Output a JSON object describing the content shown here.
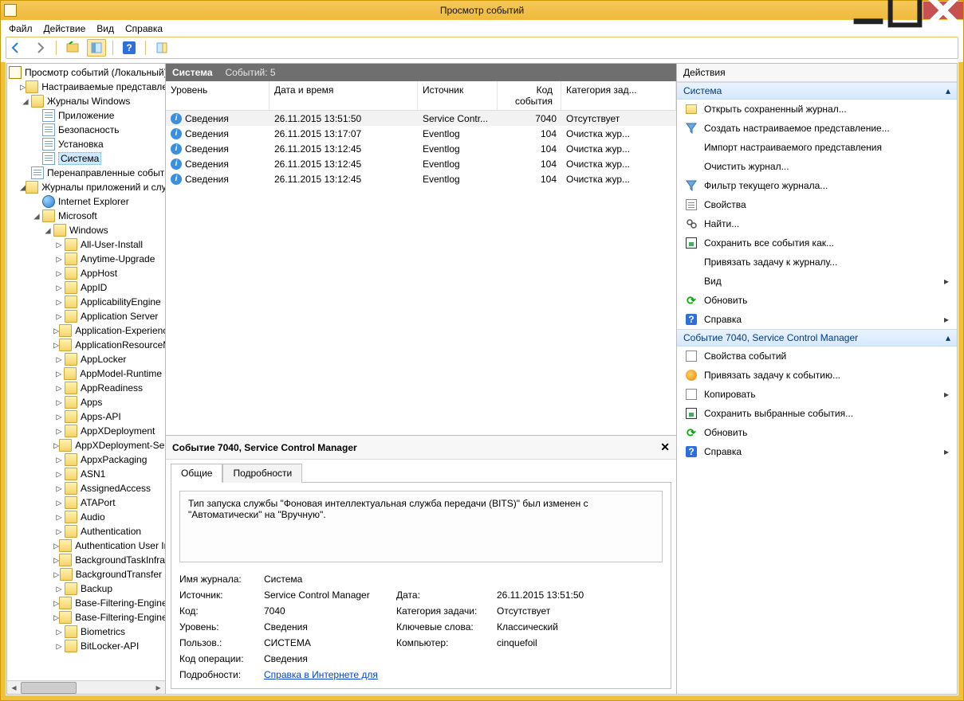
{
  "window": {
    "title": "Просмотр событий"
  },
  "menu": {
    "file": "Файл",
    "action": "Действие",
    "view": "Вид",
    "help": "Справка"
  },
  "tree": {
    "root": "Просмотр событий (Локальный)",
    "custom_views": "Настраиваемые представления",
    "win_logs": "Журналы Windows",
    "app": "Приложение",
    "security": "Безопасность",
    "setup": "Установка",
    "system": "Система",
    "forwarded": "Перенаправленные события",
    "app_svc_logs": "Журналы приложений и служб",
    "ie": "Internet Explorer",
    "microsoft": "Microsoft",
    "windows": "Windows",
    "nodes": [
      "All-User-Install",
      "Anytime-Upgrade",
      "AppHost",
      "AppID",
      "ApplicabilityEngine",
      "Application Server",
      "Application-Experience",
      "ApplicationResourceManagement",
      "AppLocker",
      "AppModel-Runtime",
      "AppReadiness",
      "Apps",
      "Apps-API",
      "AppXDeployment",
      "AppXDeployment-Server",
      "AppxPackaging",
      "ASN1",
      "AssignedAccess",
      "ATAPort",
      "Audio",
      "Authentication",
      "Authentication User Interface",
      "BackgroundTaskInfrastructure",
      "BackgroundTransfer",
      "Backup",
      "Base-Filtering-Engine",
      "Base-Filtering-Engine-Connections",
      "Biometrics",
      "BitLocker-API"
    ]
  },
  "grid": {
    "title": "Система",
    "count_label": "Событий: 5",
    "cols": {
      "level": "Уровень",
      "date": "Дата и время",
      "source": "Источник",
      "code": "Код события",
      "category": "Категория зад..."
    },
    "rows": [
      {
        "level": "Сведения",
        "date": "26.11.2015 13:51:50",
        "source": "Service Contr...",
        "code": "7040",
        "category": "Отсутствует"
      },
      {
        "level": "Сведения",
        "date": "26.11.2015 13:17:07",
        "source": "Eventlog",
        "code": "104",
        "category": "Очистка жур..."
      },
      {
        "level": "Сведения",
        "date": "26.11.2015 13:12:45",
        "source": "Eventlog",
        "code": "104",
        "category": "Очистка жур..."
      },
      {
        "level": "Сведения",
        "date": "26.11.2015 13:12:45",
        "source": "Eventlog",
        "code": "104",
        "category": "Очистка жур..."
      },
      {
        "level": "Сведения",
        "date": "26.11.2015 13:12:45",
        "source": "Eventlog",
        "code": "104",
        "category": "Очистка жур..."
      }
    ]
  },
  "detail": {
    "title": "Событие 7040, Service Control Manager",
    "tab_general": "Общие",
    "tab_details": "Подробности",
    "message": "Тип запуска службы \"Фоновая интеллектуальная служба передачи (BITS)\" был изменен с \"Автоматически\" на \"Вручную\".",
    "labels": {
      "log": "Имя журнала:",
      "source": "Источник:",
      "code": "Код:",
      "level": "Уровень:",
      "user": "Пользов.:",
      "opcode": "Код операции:",
      "more": "Подробности:",
      "date": "Дата:",
      "taskcat": "Категория задачи:",
      "keywords": "Ключевые слова:",
      "computer": "Компьютер:"
    },
    "values": {
      "log": "Система",
      "source": "Service Control Manager",
      "code": "7040",
      "level": "Сведения",
      "user": "СИСТЕМА",
      "opcode": "Сведения",
      "date": "26.11.2015 13:51:50",
      "taskcat": "Отсутствует",
      "keywords": "Классический",
      "computer": "cinquefoil",
      "more_link": "Справка в Интернете для "
    }
  },
  "actions": {
    "pane_title": "Действия",
    "section1": "Система",
    "section2": "Событие 7040, Service Control Manager",
    "items1": {
      "open_saved": "Открыть сохраненный журнал...",
      "create_view": "Создать настраиваемое представление...",
      "import_view": "Импорт настраиваемого представления",
      "clear_log": "Очистить журнал...",
      "filter": "Фильтр текущего журнала...",
      "props": "Свойства",
      "find": "Найти...",
      "save_all": "Сохранить все события как...",
      "attach_task": "Привязать задачу к журналу...",
      "view": "Вид",
      "refresh": "Обновить",
      "help": "Справка"
    },
    "items2": {
      "event_props": "Свойства событий",
      "attach_task_evt": "Привязать задачу к событию...",
      "copy": "Копировать",
      "save_selected": "Сохранить выбранные события...",
      "refresh": "Обновить",
      "help": "Справка"
    }
  }
}
